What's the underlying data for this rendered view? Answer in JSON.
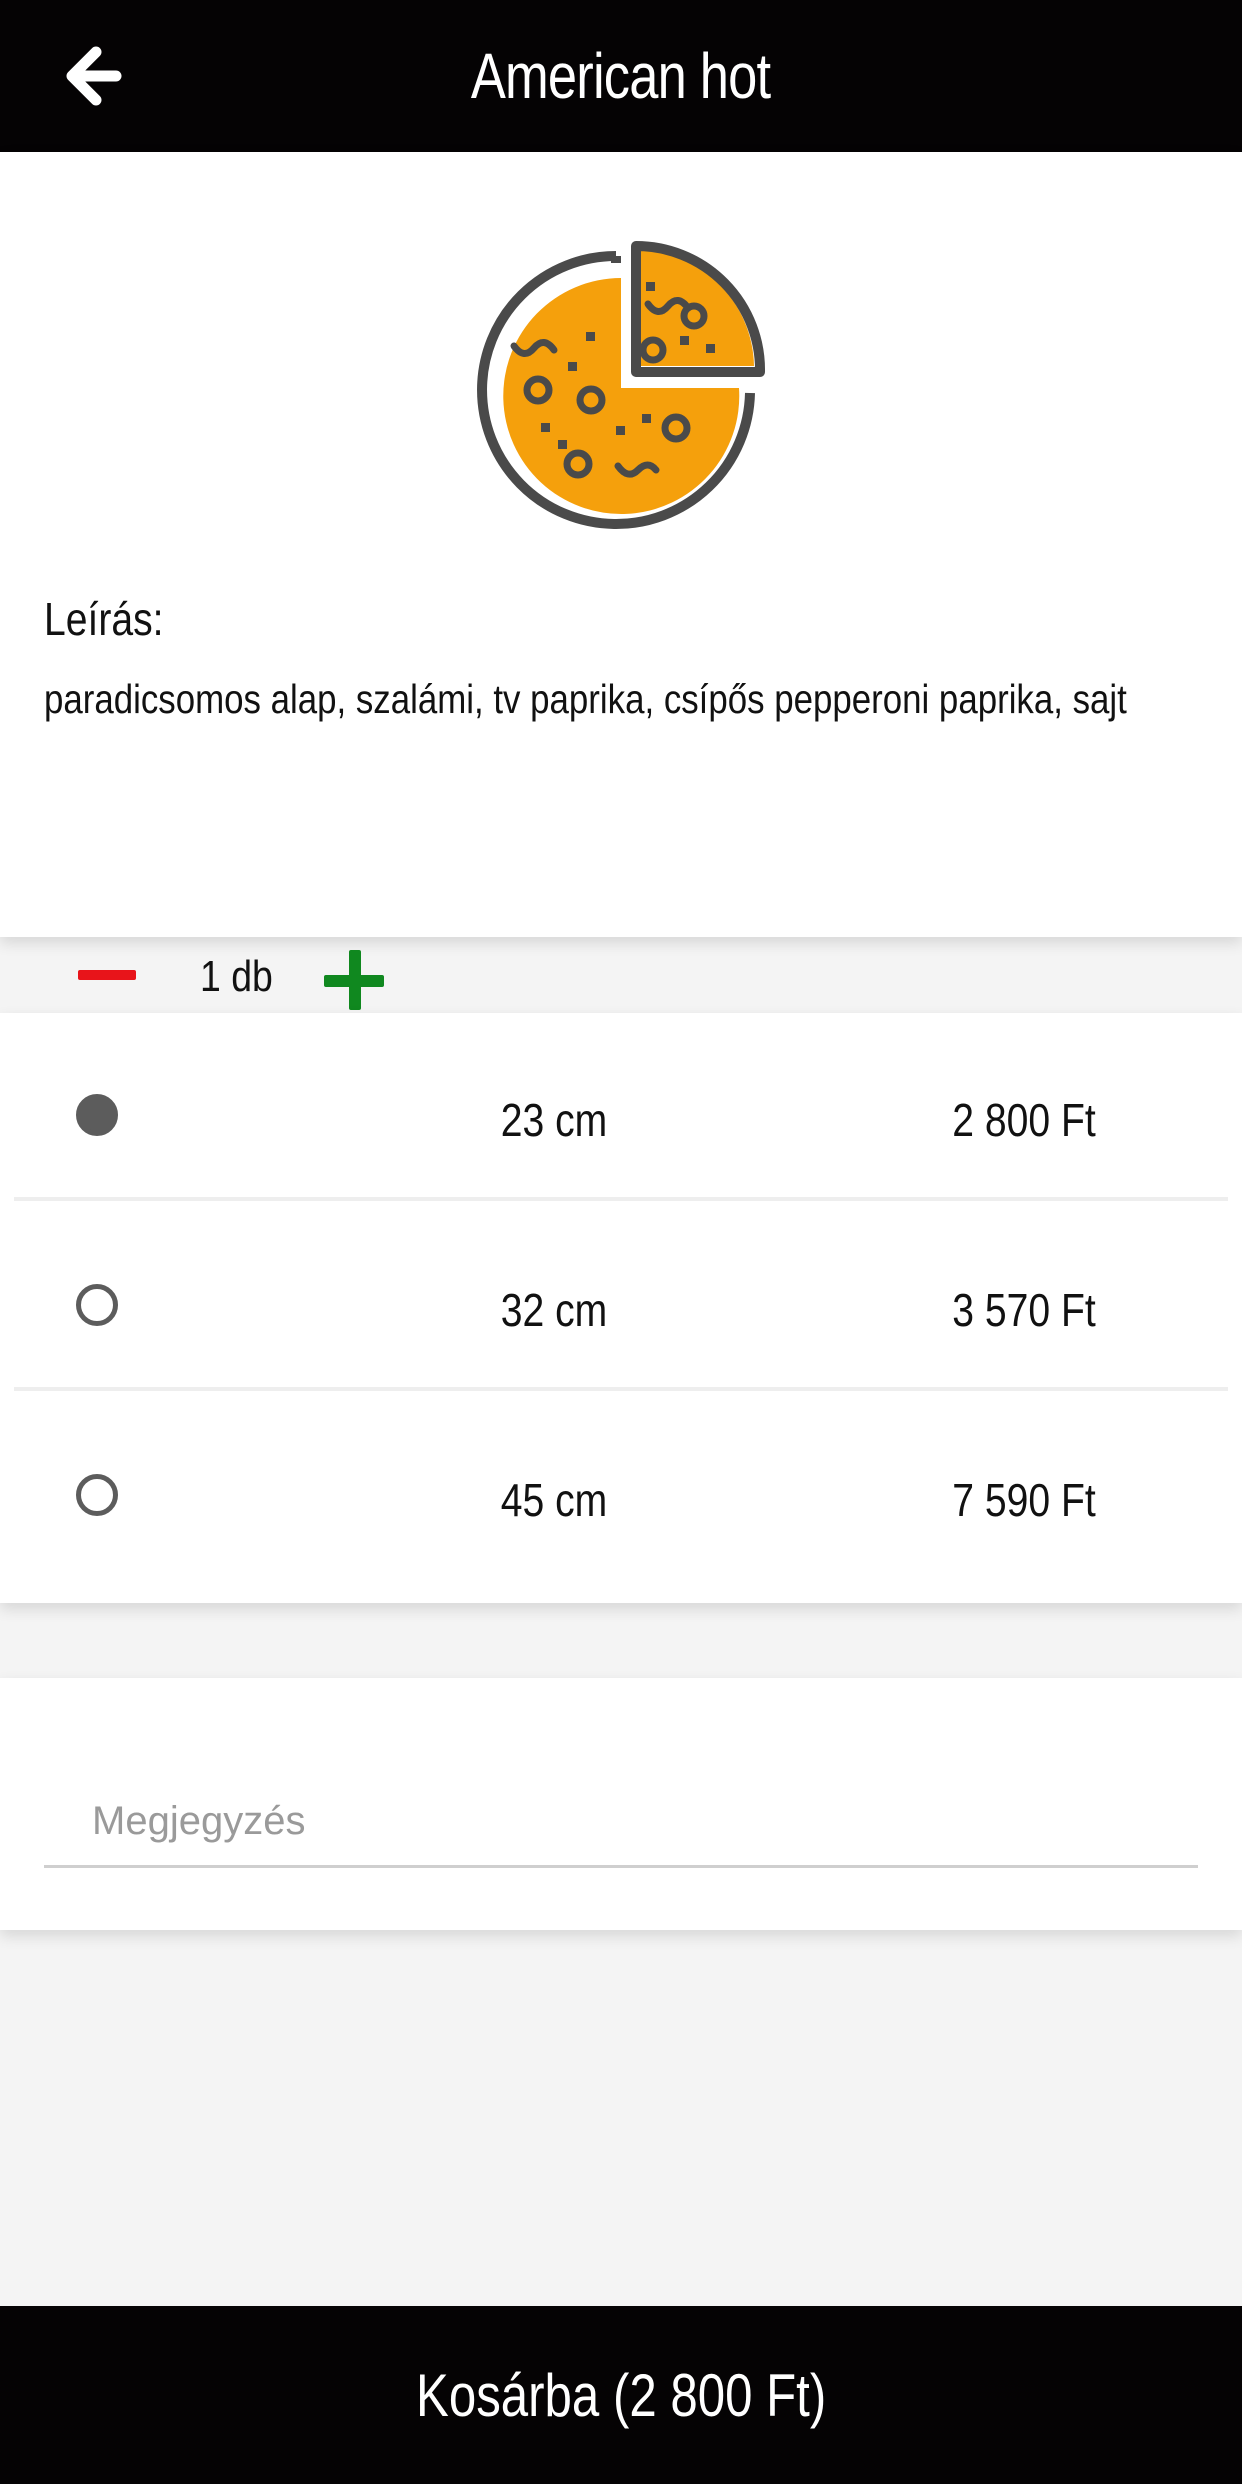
{
  "header": {
    "title": "American hot",
    "back_icon": "arrow-left-icon"
  },
  "product": {
    "image_icon": "pizza-icon",
    "image_colors": {
      "fill": "#f5a00c",
      "outline": "#4a4a4a"
    },
    "description_label": "Leírás:",
    "description": "paradicsomos alap, szalámi, tv paprika, csípős pepperoni paprika, sajt",
    "quantity": {
      "value_text": "1 db",
      "minus_icon": "minus-icon",
      "plus_icon": "plus-icon",
      "minus_color": "#e8141a",
      "plus_color": "#10881f"
    }
  },
  "sizes": [
    {
      "size": "23 cm",
      "price": "2 800 Ft",
      "selected": true
    },
    {
      "size": "32 cm",
      "price": "3 570 Ft",
      "selected": false
    },
    {
      "size": "45 cm",
      "price": "7 590 Ft",
      "selected": false
    }
  ],
  "note": {
    "placeholder": "Megjegyzés",
    "value": ""
  },
  "footer": {
    "cart_button_label": "Kosárba (2 800 Ft)"
  }
}
